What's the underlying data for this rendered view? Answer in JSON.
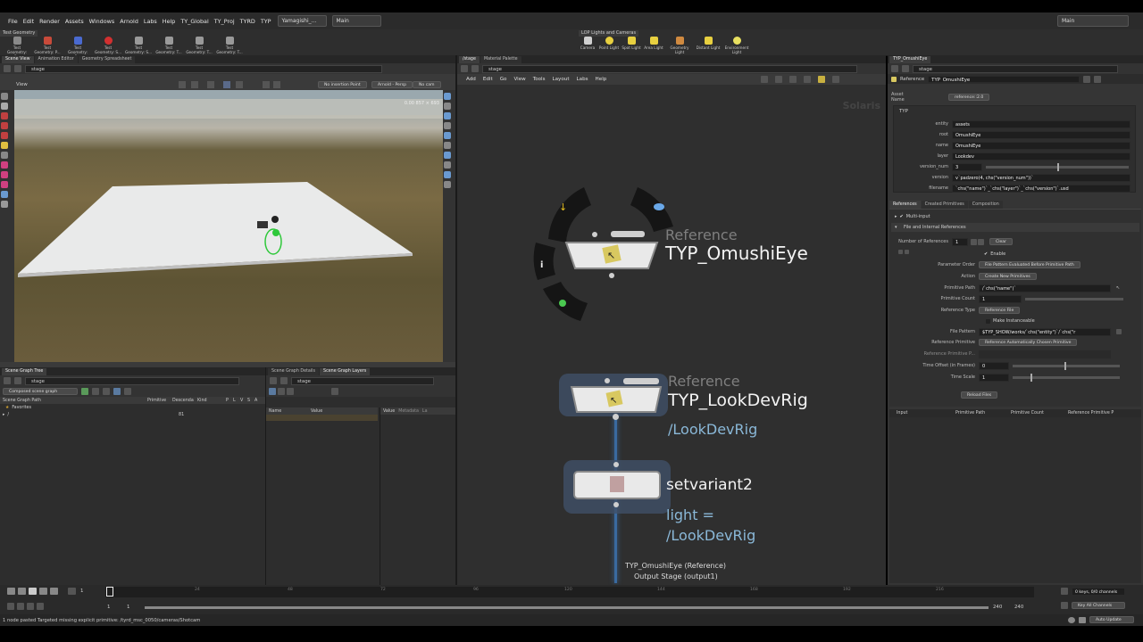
{
  "menu": {
    "items": [
      "File",
      "Edit",
      "Render",
      "Assets",
      "Windows",
      "Arnold",
      "Labs",
      "Help",
      "TY_Global",
      "TY_Proj",
      "TYRD",
      "TYP"
    ],
    "desktop": "Yamagishi_...",
    "main_label": "Main",
    "right_label": "Main"
  },
  "shelf_left": {
    "tab": "Test Geometry",
    "tools": [
      "Test Geometry: C...",
      "Test Geometry: P...",
      "Test Geometry: R...",
      "Test Geometry: S...",
      "Test Geometry: S...",
      "Test Geometry: T...",
      "Test Geometry: T...",
      "Test Geometry: T..."
    ]
  },
  "shelf_right": {
    "tab": "LOP Lights and Cameras",
    "tools": [
      "Camera",
      "Point Light",
      "Spot Light",
      "Area Light",
      "Geometry Light",
      "Distant Light",
      "Environment Light"
    ]
  },
  "viewer": {
    "tabs": [
      "Scene View",
      "Animation Editor",
      "Geometry Spreadsheet"
    ],
    "path": "stage",
    "view_label": "View",
    "insertion": "No insertion Point",
    "renderer": "Arnold - Persp",
    "camera": "No cam",
    "overlay": "0.00  857 × 693"
  },
  "scene_graph": {
    "tabs": [
      "Scene Graph Tree"
    ],
    "path": "stage",
    "filter": "Composed scene graph",
    "columns": [
      "Scene Graph Path",
      "Primitive",
      "Descenda",
      "Kind",
      "P",
      "L",
      "V",
      "S",
      "A"
    ],
    "rows": [
      {
        "name": "Favorites",
        "count": ""
      },
      {
        "name": "/",
        "count": "81"
      }
    ]
  },
  "details": {
    "tabs": [
      "Scene Graph Details",
      "Scene Graph Layers"
    ],
    "path": "stage",
    "columns": [
      "Name",
      "Value"
    ],
    "value_columns": [
      "Value",
      "Metadata",
      "La"
    ]
  },
  "network": {
    "tabs": [
      "/stage",
      "Material Palette"
    ],
    "path": "stage",
    "menu": [
      "Add",
      "Edit",
      "Go",
      "View",
      "Tools",
      "Layout",
      "Labs",
      "Help"
    ],
    "watermark": "Solaris",
    "nodes": [
      {
        "type": "Reference",
        "name": "TYP_OmushiEye",
        "sub": ""
      },
      {
        "type": "Reference",
        "name": "TYP_LookDevRig",
        "sub": "/LookDevRig"
      },
      {
        "type": "",
        "name": "setvariant2",
        "sub": "light =\n/LookDevRig"
      }
    ],
    "output_label": "TYP_OmushiEye (Reference)",
    "output_stage": "Output Stage (output1)"
  },
  "params": {
    "tab": "TYP_OmushiEye",
    "path": "stage",
    "node_type": "Reference",
    "node_name": "TYP_OmushiEye",
    "asset_name_label": "Asset Name",
    "asset_name_value": "reference::2.0",
    "section": "TYP",
    "fields": [
      {
        "label": "entity",
        "value": "assets"
      },
      {
        "label": "root",
        "value": "OmushiEye"
      },
      {
        "label": "name",
        "value": "OmushiEye"
      },
      {
        "label": "layer",
        "value": "Lookdev"
      },
      {
        "label": "version_num",
        "value": "3"
      },
      {
        "label": "version",
        "value": "v`padzero(4, chs(\"version_num\"))`"
      },
      {
        "label": "filename",
        "value": "`chs(\"name\")`_`chs(\"layer\")`_`chs(\"version\")`.usd"
      }
    ],
    "subtabs": [
      "References",
      "Created Primitives",
      "Composition"
    ],
    "multi_input": "Multi-input",
    "file_section": "File and Internal References",
    "num_refs_label": "Number of References",
    "num_refs_value": "1",
    "clear": "Clear",
    "enable": "Enable",
    "ref_rows": [
      {
        "label": "Parameter Order",
        "value": "File Pattern Evaluated Before Primitive Path"
      },
      {
        "label": "Action",
        "value": "Create New Primitives"
      },
      {
        "label": "Primitive Path",
        "value": "/`chs(\"name\")`"
      },
      {
        "label": "Primitive Count",
        "value": "1"
      },
      {
        "label": "Reference Type",
        "value": "Reference File"
      }
    ],
    "make_instanceable": "Make Instanceable",
    "file_pattern_label": "File Pattern",
    "file_pattern_value": "$TYP_SHOW/works/`chs(\"entity\")`/`chs(\"r",
    "ref_prim_label": "Reference Primitive",
    "ref_prim_value": "Reference Automatically Chosen Primitive",
    "ref_prim_path_label": "Reference Primitive P...",
    "time_offset_label": "Time Offset (in Frames)",
    "time_offset_value": "0",
    "time_scale_label": "Time Scale",
    "time_scale_value": "1",
    "reload": "Reload Files",
    "table_cols": [
      "Input",
      "Primitive Path",
      "Primitive Count",
      "Reference Primitive P"
    ]
  },
  "timeline": {
    "frame": "1",
    "ticks": [
      "24",
      "48",
      "72",
      "96",
      "120",
      "144",
      "168",
      "192",
      "216"
    ],
    "start": "1",
    "start2": "1",
    "end": "240",
    "end2": "240",
    "keys": "0 keys, 0/0 channels",
    "key_all": "Key All Channels",
    "auto_update": "Auto Update"
  },
  "status": "1 node pasted     Targeted missing explicit primitive: /tyrd_msc_0050/cameras/Shotcam"
}
